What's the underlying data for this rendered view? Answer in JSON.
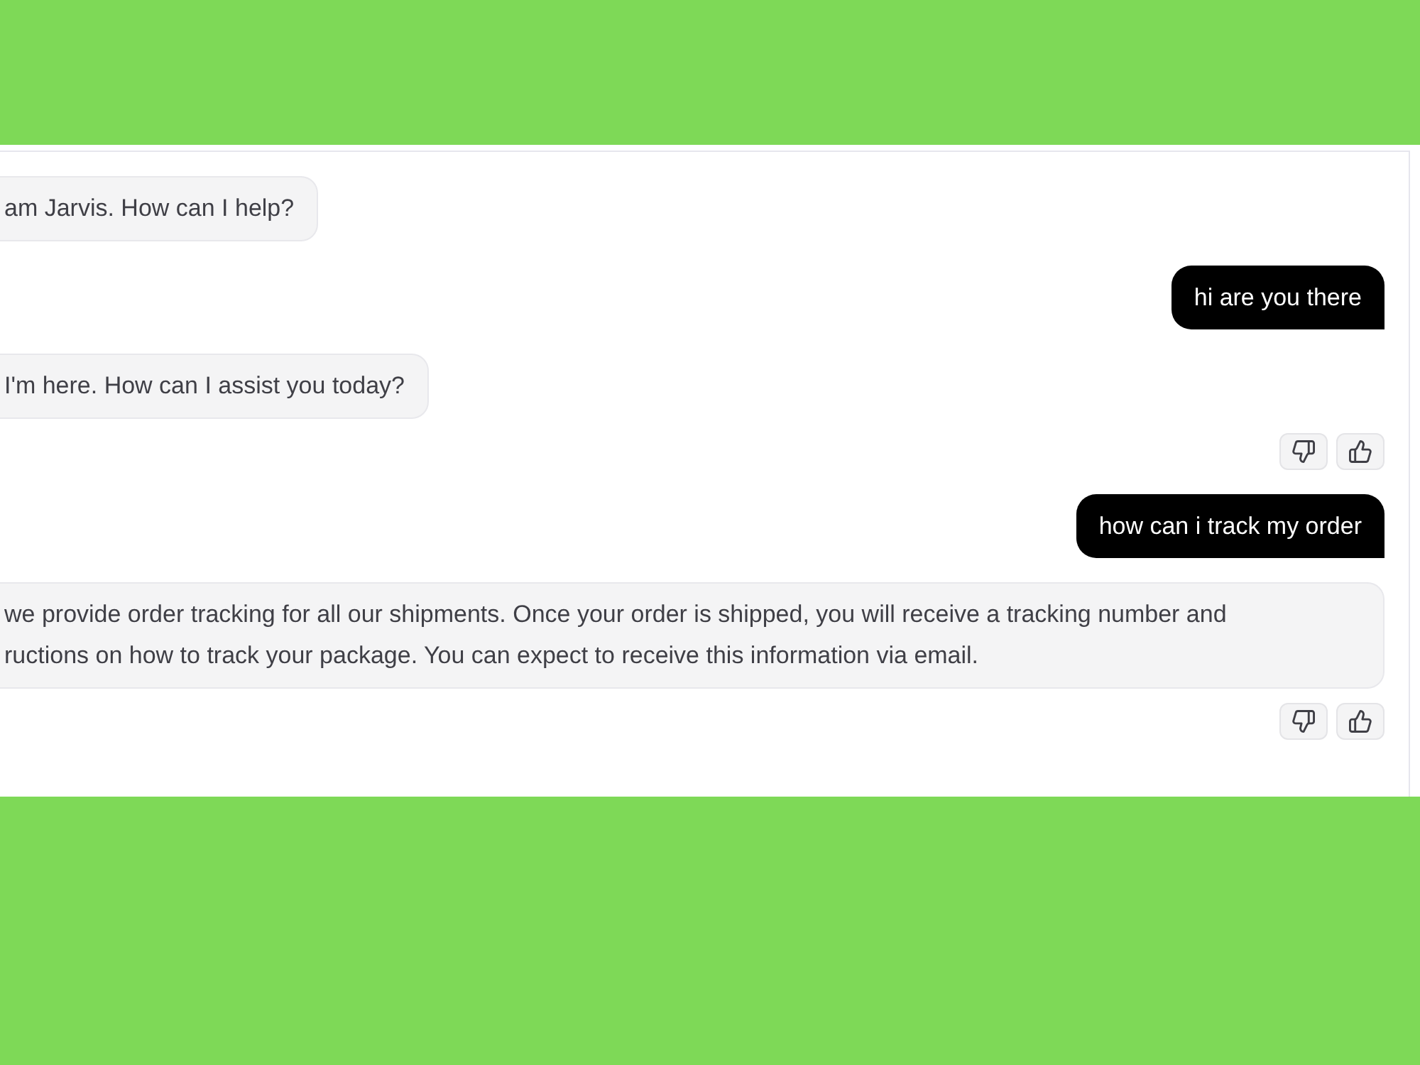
{
  "messages": [
    {
      "kind": "bot",
      "lines": [
        "am Jarvis. How can I help?"
      ],
      "feedback": false
    },
    {
      "kind": "user",
      "text": "hi are you there"
    },
    {
      "kind": "bot",
      "lines": [
        "I'm here. How can I assist you today?"
      ],
      "feedback": true
    },
    {
      "kind": "user",
      "text": "how can i track my order"
    },
    {
      "kind": "bot",
      "lines": [
        "we provide order tracking for all our shipments. Once your order is shipped, you will receive a tracking number and",
        "ructions on how to track your package. You can expect to receive this information via email."
      ],
      "feedback": true
    }
  ]
}
